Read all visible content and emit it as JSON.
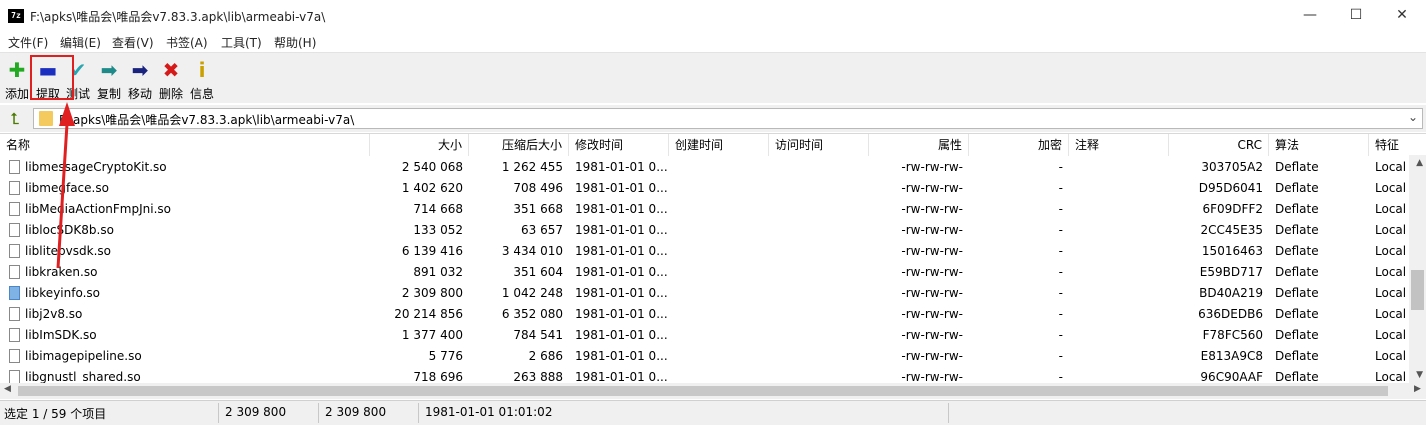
{
  "window": {
    "app_icon": "7z",
    "title": "F:\\apks\\唯品会\\唯品会v7.83.3.apk\\lib\\armeabi-v7a\\",
    "minimize": "—",
    "maximize": "☐",
    "close": "✕"
  },
  "menu": [
    "文件(F)",
    "编辑(E)",
    "查看(V)",
    "书签(A)",
    "工具(T)",
    "帮助(H)"
  ],
  "toolbar": [
    {
      "label": "添加",
      "icon": "add-icon",
      "glyph": "✚",
      "color": "#22aa22"
    },
    {
      "label": "提取",
      "icon": "extract-icon",
      "glyph": "▬",
      "color": "#1a2fbf"
    },
    {
      "label": "测试",
      "icon": "test-icon",
      "glyph": "✔",
      "color": "#2aa6b0"
    },
    {
      "label": "复制",
      "icon": "copy-icon",
      "glyph": "➡",
      "color": "#1f8a8a"
    },
    {
      "label": "移动",
      "icon": "move-icon",
      "glyph": "➡",
      "color": "#1a237e"
    },
    {
      "label": "删除",
      "icon": "delete-icon",
      "glyph": "✖",
      "color": "#d61a1a"
    },
    {
      "label": "信息",
      "icon": "info-icon",
      "glyph": "i",
      "color": "#c9a000"
    }
  ],
  "address": {
    "path": "F:\\apks\\唯品会\\唯品会v7.83.3.apk\\lib\\armeabi-v7a\\",
    "up_glyph": "⮤",
    "dropdown": "⌄"
  },
  "columns": [
    "名称",
    "大小",
    "压缩后大小",
    "修改时间",
    "创建时间",
    "访问时间",
    "属性",
    "加密",
    "注释",
    "CRC",
    "算法",
    "特征"
  ],
  "files": [
    {
      "name": "libmessageCryptoKit.so",
      "size": "2 540 068",
      "packed": "1 262 455",
      "modified": "1981-01-01 0...",
      "attr": "-rw-rw-rw-",
      "enc": "-",
      "crc": "303705A2",
      "method": "Deflate",
      "char": "Local"
    },
    {
      "name": "libmegface.so",
      "size": "1 402 620",
      "packed": "708 496",
      "modified": "1981-01-01 0...",
      "attr": "-rw-rw-rw-",
      "enc": "-",
      "crc": "D95D6041",
      "method": "Deflate",
      "char": "Local"
    },
    {
      "name": "libMediaActionFmpJni.so",
      "size": "714 668",
      "packed": "351 668",
      "modified": "1981-01-01 0...",
      "attr": "-rw-rw-rw-",
      "enc": "-",
      "crc": "6F09DFF2",
      "method": "Deflate",
      "char": "Local"
    },
    {
      "name": "liblocSDK8b.so",
      "size": "133 052",
      "packed": "63 657",
      "modified": "1981-01-01 0...",
      "attr": "-rw-rw-rw-",
      "enc": "-",
      "crc": "2CC45E35",
      "method": "Deflate",
      "char": "Local"
    },
    {
      "name": "liblitepvsdk.so",
      "size": "6 139 416",
      "packed": "3 434 010",
      "modified": "1981-01-01 0...",
      "attr": "-rw-rw-rw-",
      "enc": "-",
      "crc": "15016463",
      "method": "Deflate",
      "char": "Local"
    },
    {
      "name": "libkraken.so",
      "size": "891 032",
      "packed": "351 604",
      "modified": "1981-01-01 0...",
      "attr": "-rw-rw-rw-",
      "enc": "-",
      "crc": "E59BD717",
      "method": "Deflate",
      "char": "Local"
    },
    {
      "name": "libkeyinfo.so",
      "size": "2 309 800",
      "packed": "1 042 248",
      "modified": "1981-01-01 0...",
      "attr": "-rw-rw-rw-",
      "enc": "-",
      "crc": "BD40A219",
      "method": "Deflate",
      "char": "Local",
      "selected": true
    },
    {
      "name": "libj2v8.so",
      "size": "20 214 856",
      "packed": "6 352 080",
      "modified": "1981-01-01 0...",
      "attr": "-rw-rw-rw-",
      "enc": "-",
      "crc": "636DEDB6",
      "method": "Deflate",
      "char": "Local"
    },
    {
      "name": "libImSDK.so",
      "size": "1 377 400",
      "packed": "784 541",
      "modified": "1981-01-01 0...",
      "attr": "-rw-rw-rw-",
      "enc": "-",
      "crc": "F78FC560",
      "method": "Deflate",
      "char": "Local"
    },
    {
      "name": "libimagepipeline.so",
      "size": "5 776",
      "packed": "2 686",
      "modified": "1981-01-01 0...",
      "attr": "-rw-rw-rw-",
      "enc": "-",
      "crc": "E813A9C8",
      "method": "Deflate",
      "char": "Local"
    },
    {
      "name": "libgnustl_shared.so",
      "size": "718 696",
      "packed": "263 888",
      "modified": "1981-01-01 0...",
      "attr": "-rw-rw-rw-",
      "enc": "-",
      "crc": "96C90AAF",
      "method": "Deflate",
      "char": "Local"
    }
  ],
  "status": {
    "selection": "选定 1 / 59 个项目",
    "size": "2 309 800",
    "packed": "2 309 800",
    "modified": "1981-01-01 01:01:02"
  },
  "annotation_color": "#e02020"
}
